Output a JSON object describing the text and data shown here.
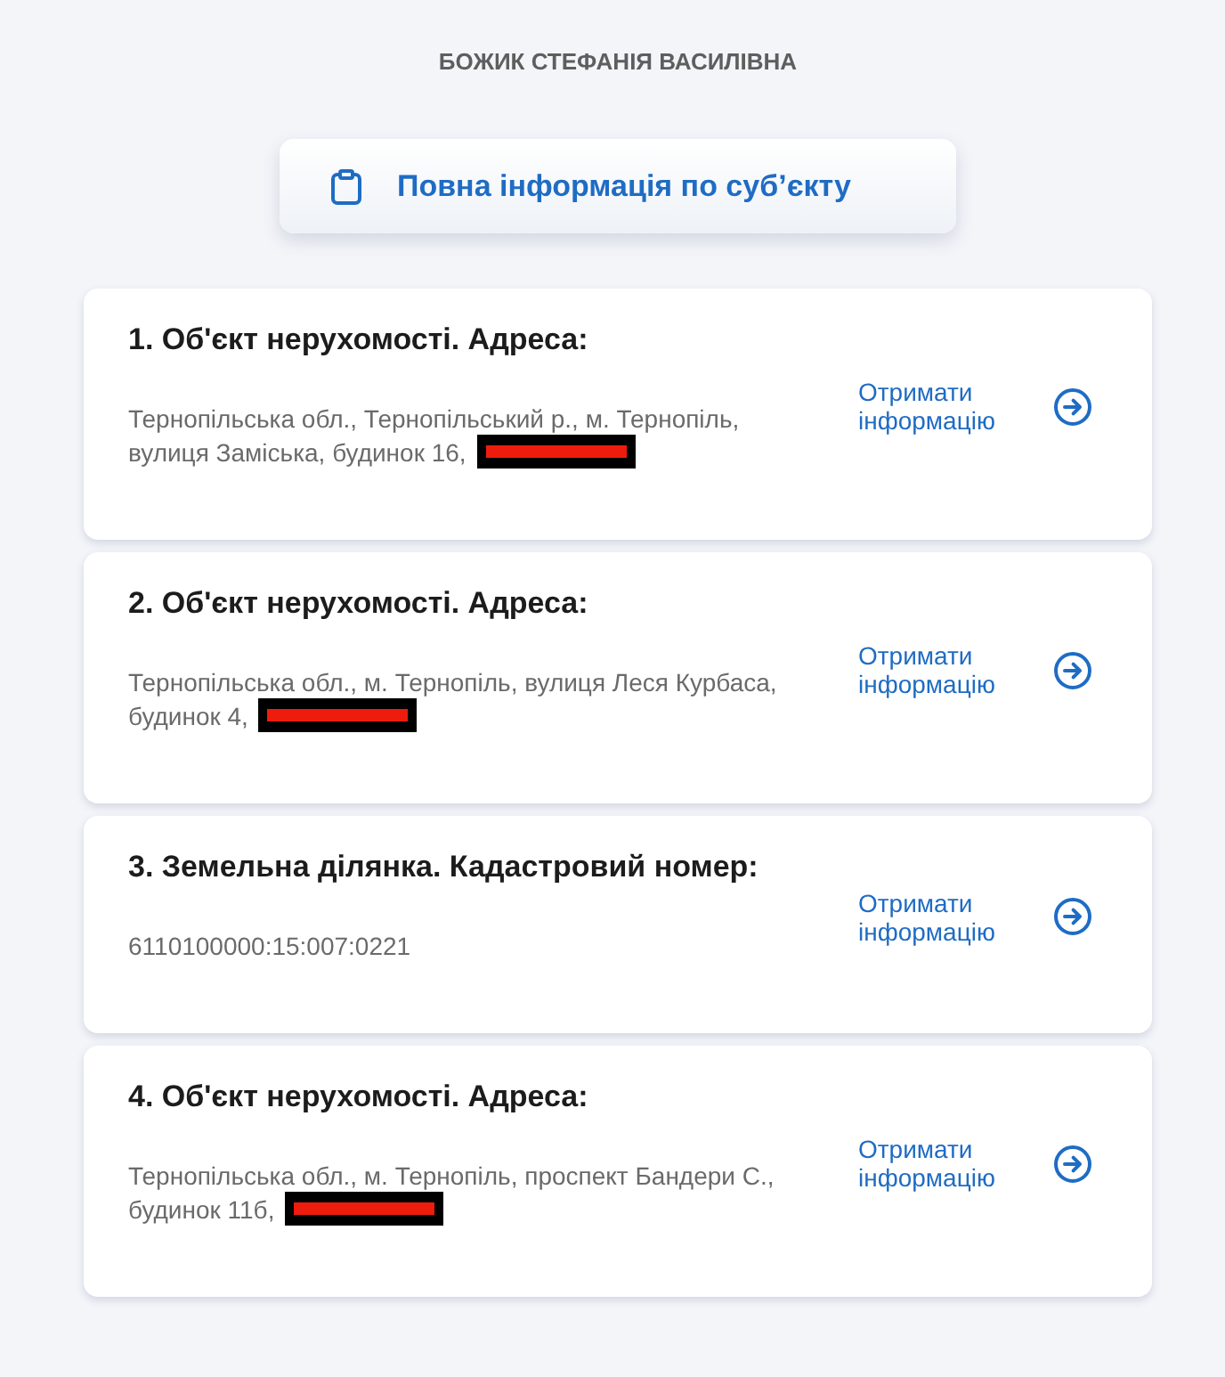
{
  "header": {
    "title": "БОЖИК СТЕФАНІЯ ВАСИЛІВНА"
  },
  "subject_button": {
    "label": "Повна інформація по суб’єкту"
  },
  "objects": [
    {
      "title": "1. Об'єкт нерухомості. Адреса:",
      "value_lines": [
        "Тернопільська обл., Тернопільський р., м. Тернопіль,",
        "вулиця Заміська, будинок 16,"
      ],
      "redacted": true,
      "link": "Отримати інформацію"
    },
    {
      "title": "2. Об'єкт нерухомості. Адреса:",
      "value_lines": [
        "Тернопільська обл., м. Тернопіль, вулиця Леся Курбаса,",
        "будинок 4,"
      ],
      "redacted": true,
      "link": "Отримати інформацію"
    },
    {
      "title": "3. Земельна ділянка. Кадастровий номер:",
      "value_lines": [
        "6110100000:15:007:0221"
      ],
      "redacted": false,
      "link": "Отримати інформацію"
    },
    {
      "title": "4. Об'єкт нерухомості. Адреса:",
      "value_lines": [
        "Тернопільська обл., м. Тернопіль, проспект Бандери С.,",
        "будинок 11б,"
      ],
      "redacted": true,
      "link": "Отримати інформацію"
    }
  ]
}
